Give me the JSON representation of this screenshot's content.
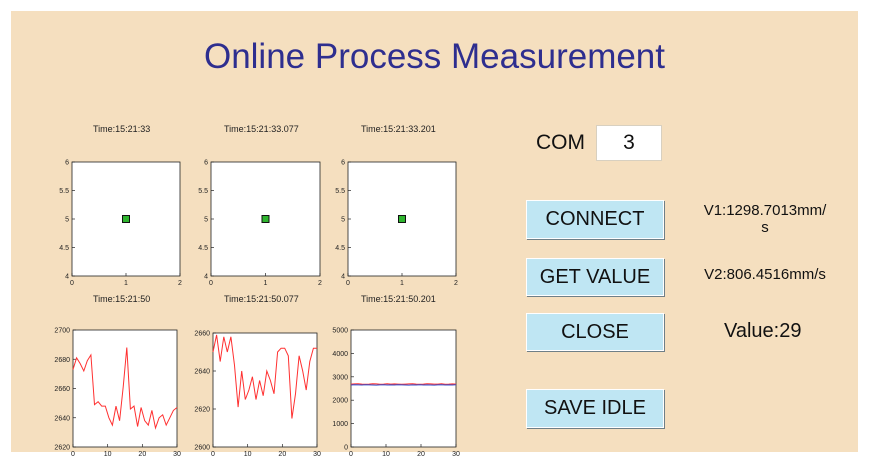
{
  "app": {
    "title": "Online Process Measurement"
  },
  "plots": [
    {
      "time": "Time:15:21:33",
      "type": "scatter",
      "x": [
        1
      ],
      "y": [
        5
      ],
      "xlim": [
        0,
        2
      ],
      "ylim": [
        4,
        6
      ],
      "xticks": [
        "0",
        "1",
        "2"
      ],
      "yticks": [
        "4",
        "4.5",
        "5",
        "5.5",
        "6"
      ]
    },
    {
      "time": "Time:15:21:33.077",
      "type": "scatter",
      "x": [
        1
      ],
      "y": [
        5
      ],
      "xlim": [
        0,
        2
      ],
      "ylim": [
        4,
        6
      ],
      "xticks": [
        "0",
        "1",
        "2"
      ],
      "yticks": [
        "4",
        "4.5",
        "5",
        "5.5",
        "6"
      ]
    },
    {
      "time": "Time:15:21:33.201",
      "type": "scatter",
      "x": [
        1
      ],
      "y": [
        5
      ],
      "xlim": [
        0,
        2
      ],
      "ylim": [
        4,
        6
      ],
      "xticks": [
        "0",
        "1",
        "2"
      ],
      "yticks": [
        "4",
        "4.5",
        "5",
        "5.5",
        "6"
      ]
    },
    {
      "time": "Time:15:21:50",
      "type": "line",
      "xlim": [
        0,
        30
      ],
      "ylim": [
        2620,
        2700
      ],
      "xticks": [
        "0",
        "10",
        "20",
        "30"
      ],
      "yticks": [
        "2620",
        "2640",
        "2660",
        "2680",
        "2700"
      ],
      "series": [
        {
          "color": "#ff3030",
          "values": [
            2673,
            2681,
            2677,
            2672,
            2679,
            2683,
            2649,
            2651,
            2648,
            2648,
            2640,
            2635,
            2648,
            2638,
            2661,
            2688,
            2646,
            2648,
            2634,
            2647,
            2638,
            2635,
            2645,
            2633,
            2640,
            2642,
            2635,
            2640,
            2645,
            2647
          ]
        }
      ]
    },
    {
      "time": "Time:15:21:50.077",
      "type": "line",
      "xlim": [
        0,
        30
      ],
      "ylim": [
        2600,
        2660
      ],
      "xticks": [
        "0",
        "10",
        "20",
        "30"
      ],
      "yticks": [
        "2600",
        "2620",
        "2640",
        "2660"
      ],
      "series": [
        {
          "color": "#ff3030",
          "values": [
            2650,
            2659,
            2645,
            2658,
            2650,
            2658,
            2643,
            2621,
            2640,
            2625,
            2630,
            2637,
            2625,
            2635,
            2627,
            2640,
            2635,
            2628,
            2650,
            2652,
            2652,
            2648,
            2615,
            2628,
            2648,
            2640,
            2630,
            2645,
            2652,
            2652
          ]
        }
      ]
    },
    {
      "time": "Time:15:21:50.201",
      "type": "line",
      "xlim": [
        0,
        30
      ],
      "ylim": [
        0,
        5000
      ],
      "xticks": [
        "0",
        "10",
        "20",
        "30"
      ],
      "yticks": [
        "0",
        "1000",
        "2000",
        "3000",
        "4000",
        "5000"
      ],
      "series": [
        {
          "color": "#ff3030",
          "values": [
            2690,
            2695,
            2700,
            2690,
            2685,
            2690,
            2700,
            2695,
            2680,
            2690,
            2700,
            2690,
            2695,
            2690,
            2680,
            2690,
            2695,
            2700,
            2690,
            2685,
            2690,
            2700,
            2695,
            2690,
            2690,
            2700,
            2685,
            2690,
            2695,
            2690
          ]
        },
        {
          "color": "#3050d0",
          "values": [
            2650,
            2660,
            2655,
            2650,
            2660,
            2655,
            2650,
            2645,
            2655,
            2660,
            2650,
            2655,
            2650,
            2660,
            2655,
            2650,
            2645,
            2655,
            2650,
            2660,
            2650,
            2655,
            2650,
            2645,
            2655,
            2660,
            2650,
            2655,
            2650,
            2660
          ]
        }
      ]
    }
  ],
  "com": {
    "label": "COM",
    "value": "3"
  },
  "buttons": {
    "connect": "CONNECT",
    "get_value": "GET VALUE",
    "close": "CLOSE",
    "save_idle": "SAVE IDLE"
  },
  "readouts": {
    "v1": "V1:1298.7013mm/\ns",
    "v2": "V2:806.4516mm/s",
    "value": "Value:29"
  },
  "colors": {
    "background": "#f5dfbf",
    "title": "#2e2e8f",
    "button": "#bfe6f3",
    "marker": "#2fb52f"
  }
}
